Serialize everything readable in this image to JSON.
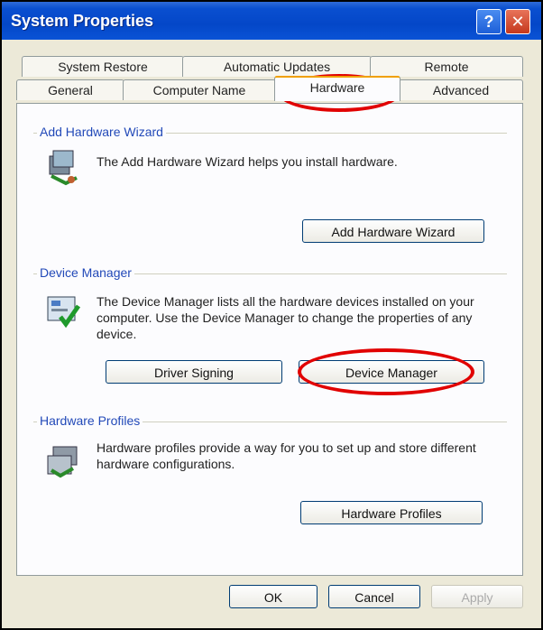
{
  "window": {
    "title": "System Properties",
    "help_glyph": "?",
    "close_glyph": "✕"
  },
  "tabs": {
    "row1": [
      "System Restore",
      "Automatic Updates",
      "Remote"
    ],
    "row2": [
      "General",
      "Computer Name",
      "Hardware",
      "Advanced"
    ],
    "active": "Hardware"
  },
  "add_hardware": {
    "group_label": "Add Hardware Wizard",
    "description": "The Add Hardware Wizard helps you install hardware.",
    "button_label": "Add Hardware Wizard"
  },
  "device_manager": {
    "group_label": "Device Manager",
    "description": "The Device Manager lists all the hardware devices installed on your computer. Use the Device Manager to change the properties of any device.",
    "driver_button_label": "Driver Signing",
    "button_label": "Device Manager"
  },
  "hardware_profiles": {
    "group_label": "Hardware Profiles",
    "description": "Hardware profiles provide a way for you to set up and store different hardware configurations.",
    "button_label": "Hardware Profiles"
  },
  "footer": {
    "ok_label": "OK",
    "cancel_label": "Cancel",
    "apply_label": "Apply"
  },
  "annotation_color": "#e10000"
}
